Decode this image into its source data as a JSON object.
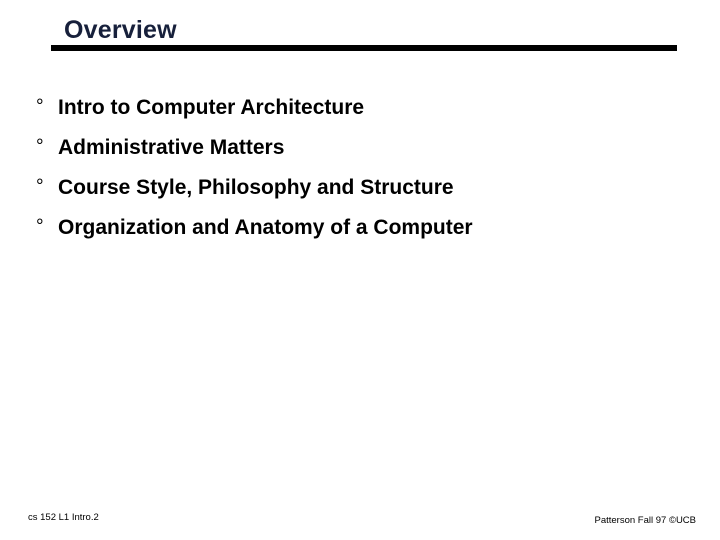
{
  "slide": {
    "title": "Overview",
    "title_color": "#17203b",
    "rule_color": "#000000",
    "background_color": "#ffffff",
    "bullet_marker": "°",
    "bullets": [
      {
        "text": "Intro to Computer Architecture"
      },
      {
        "text": "Administrative Matters"
      },
      {
        "text": "Course Style, Philosophy and Structure"
      },
      {
        "text": "Organization and Anatomy of a Computer"
      }
    ],
    "footer": {
      "left": "cs 152  L1 Intro.2",
      "right": "Patterson Fall 97 ©UCB"
    }
  }
}
